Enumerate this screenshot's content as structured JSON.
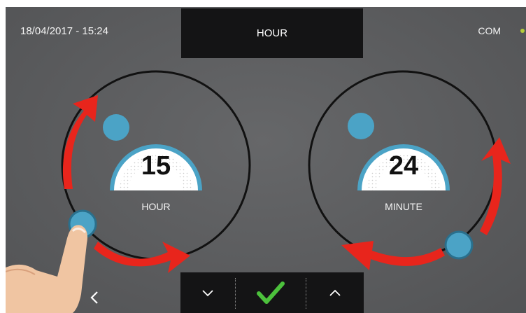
{
  "status": {
    "datetime": "18/04/2017 - 15:24",
    "com_label": "COM",
    "com_color": "#b5cc3a"
  },
  "header": {
    "title": "HOUR"
  },
  "dials": [
    {
      "id": "hour",
      "value": "15",
      "label": "HOUR"
    },
    {
      "id": "minute",
      "value": "24",
      "label": "MINUTE"
    }
  ],
  "colors": {
    "accent": "#4ba3c6",
    "arrow": "#e8251c",
    "confirm": "#4cc13c",
    "toolbar": "#141415"
  },
  "icons": {
    "back": "chevron-left-icon",
    "down": "chevron-down-icon",
    "confirm": "checkmark-icon",
    "up": "chevron-up-icon"
  }
}
